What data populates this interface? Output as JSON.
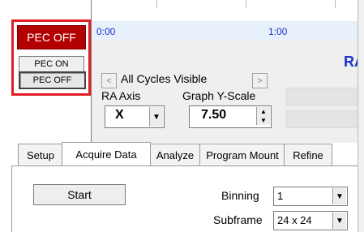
{
  "pec": {
    "status": "PEC OFF",
    "on_button": "PEC ON",
    "off_button": "PEC OFF"
  },
  "graph": {
    "axis_left": "0:00",
    "axis_mid": "1:00",
    "title_partial": "RA"
  },
  "cycles": {
    "prev": "<",
    "label": "All Cycles Visible",
    "next": ">"
  },
  "ra_axis": {
    "label": "RA Axis",
    "value": "X"
  },
  "y_scale": {
    "label": "Graph Y-Scale",
    "value": "7.50"
  },
  "tabs": [
    "Setup",
    "Acquire Data",
    "Analyze",
    "Program Mount",
    "Refine"
  ],
  "acquire": {
    "start": "Start",
    "binning_label": "Binning",
    "binning_value": "1",
    "subframe_label": "Subframe",
    "subframe_value": "24 x 24"
  }
}
